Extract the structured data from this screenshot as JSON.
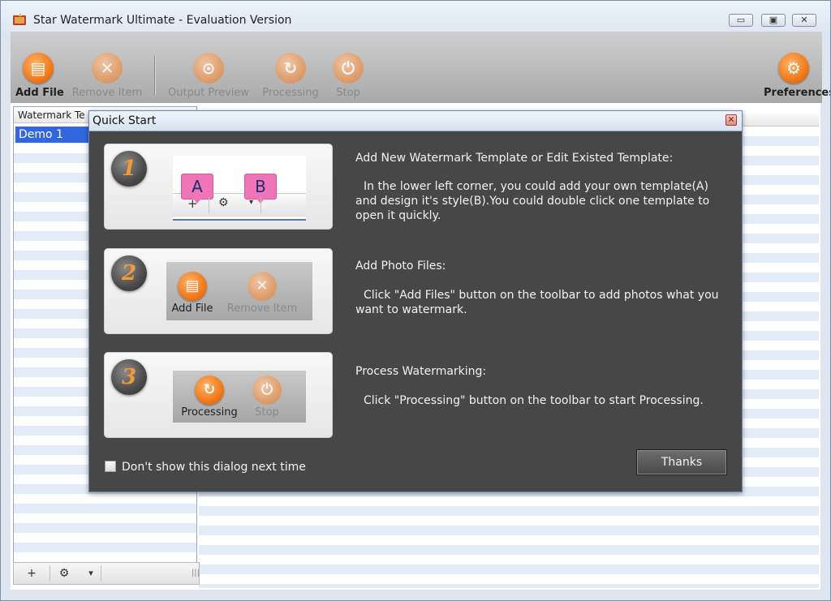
{
  "window": {
    "title": "Star Watermark Ultimate - Evaluation Version",
    "min_glyph": "▭",
    "max_glyph": "▣",
    "close_glyph": "✕"
  },
  "toolbar": {
    "add_file": "Add File",
    "remove_item": "Remove Item",
    "output_preview": "Output Preview",
    "processing": "Processing",
    "stop": "Stop",
    "preferences": "Preferences"
  },
  "left_panel": {
    "header": "Watermark Te",
    "items": [
      "Demo 1"
    ]
  },
  "bottom_bar": {
    "add": "+",
    "settings": "⚙",
    "dropdown": "▾",
    "grip": "|||"
  },
  "dialog": {
    "title": "Quick Start",
    "close": "✕",
    "steps": [
      {
        "number": "1",
        "heading": "Add New Watermark Template or Edit Existed Template:",
        "description": "In the lower left corner, you could add your own template(A) and design it's style(B).You could double click one template to open it quickly.",
        "tag_a": "A",
        "tag_b": "B"
      },
      {
        "number": "2",
        "heading": "Add Photo Files:",
        "description": "Click \"Add Files\" button on the toolbar to add photos what you want to watermark.",
        "btn1": "Add File",
        "btn2": "Remove Item"
      },
      {
        "number": "3",
        "heading": "Process Watermarking:",
        "description": "Click \"Processing\" button on the toolbar to start Processing.",
        "btn1": "Processing",
        "btn2": "Stop"
      }
    ],
    "checkbox_label": "Don't show this dialog next time",
    "checkbox_checked": false,
    "thanks_button": "Thanks"
  },
  "colors": {
    "accent_orange": "#f07a1a",
    "selection_blue": "#3366dd",
    "dialog_bg": "#474747"
  },
  "icons": {
    "add_file": "add-file-icon",
    "remove_item": "remove-icon",
    "output_preview": "preview-icon",
    "processing": "refresh-icon",
    "stop": "power-icon",
    "preferences": "user-gear-icon"
  }
}
